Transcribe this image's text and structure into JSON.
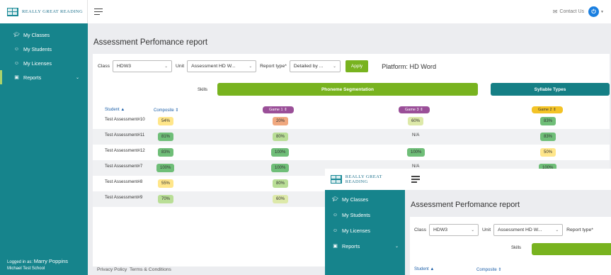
{
  "brand": {
    "name": "Really Great Reading"
  },
  "sidebar": {
    "items": [
      {
        "label": "My Classes",
        "icon": "hat-icon"
      },
      {
        "label": "My Students",
        "icon": "user-icon"
      },
      {
        "label": "My Licenses",
        "icon": "user-icon"
      },
      {
        "label": "Reports",
        "icon": "report-icon"
      }
    ],
    "footer_prefix": "Logged in as:",
    "user_name": "Marry Poppins",
    "school": "Michael Test School"
  },
  "topbar": {
    "contact": "Contact Us",
    "accent": "#1a7fe0"
  },
  "page": {
    "title": "Assessment Perfomance report",
    "filters": {
      "class_label": "Class",
      "class_value": "HDW3",
      "unit_label": "Unit",
      "unit_value": "Assessment HD W...",
      "report_label": "Report type*",
      "report_value": "Detailed by ...",
      "apply": "Apply"
    },
    "platform": "Platform: HD Word",
    "skills_label": "Skills",
    "skill_bars": [
      {
        "label": "Phoneme Segmentation",
        "color": "#78b31f"
      },
      {
        "label": "Syllable Types",
        "color": "#157f85"
      }
    ],
    "headers": {
      "student": "Student",
      "composite": "Composite"
    },
    "games": [
      {
        "label": "Game 1",
        "color": "#9a4f98"
      },
      {
        "label": "Game 3",
        "color": "#9a4f98"
      },
      {
        "label": "Game 2",
        "color": "#f3c326"
      }
    ],
    "rows": [
      {
        "student": "Test Assessment#10",
        "composite": "54%",
        "game1": "20%",
        "game3": "60%",
        "game2": "83%"
      },
      {
        "student": "Test Assessment#11",
        "composite": "81%",
        "game1": "80%",
        "game3": "N/A",
        "game2": "83%"
      },
      {
        "student": "Test Assessment#12",
        "composite": "83%",
        "game1": "100%",
        "game3": "100%",
        "game2": "50%"
      },
      {
        "student": "Test Assessment#7",
        "composite": "100%",
        "game1": "100%",
        "game3": "N/A",
        "game2": "100%"
      },
      {
        "student": "Test Assessment#8",
        "composite": "55%",
        "game1": "80%",
        "game3": "",
        "game2": ""
      },
      {
        "student": "Test Assessment#9",
        "composite": "70%",
        "game1": "60%",
        "game3": "",
        "game2": ""
      }
    ],
    "footer": {
      "privacy": "Privacy Policy",
      "terms": "Terms & Conditions"
    }
  }
}
